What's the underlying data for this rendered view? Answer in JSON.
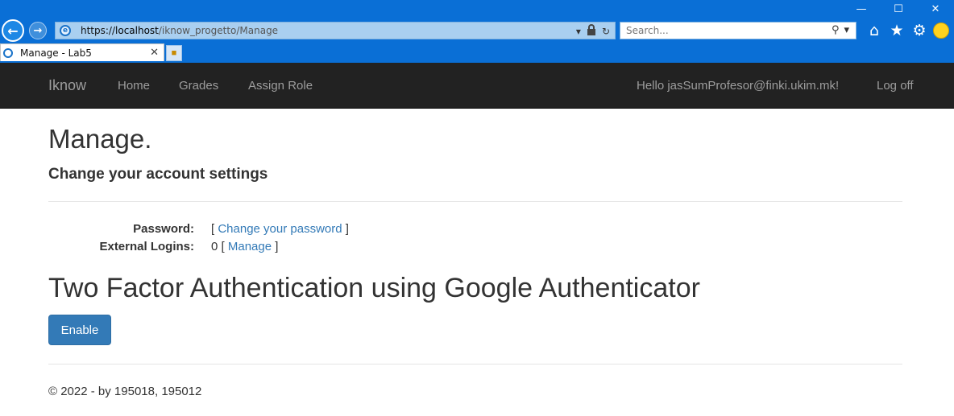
{
  "browser": {
    "address": {
      "protocol": "https://",
      "domain": "localhost",
      "path": "/iknow_progetto/Manage"
    },
    "search_placeholder": "Search...",
    "tab_title": "Manage - Lab5"
  },
  "navbar": {
    "brand": "Iknow",
    "links": [
      "Home",
      "Grades",
      "Assign Role"
    ],
    "greeting": "Hello jasSumProfesor@finki.ukim.mk!",
    "logoff": "Log off"
  },
  "page": {
    "title": "Manage.",
    "subtitle": "Change your account settings",
    "settings": {
      "password_label": "Password:",
      "password_open": "[ ",
      "password_link": "Change your password",
      "password_close": " ]",
      "external_label": "External Logins:",
      "external_count": "0",
      "external_open": " [ ",
      "external_link": "Manage",
      "external_close": " ]"
    },
    "two_factor_heading": "Two Factor Authentication using Google Authenticator",
    "enable_button": "Enable"
  },
  "footer": {
    "text": "© 2022 - by 195018, 195012"
  },
  "colors": {
    "chrome_blue": "#0a6fd6",
    "navbar_bg": "#222222",
    "link": "#337ab7",
    "primary_button": "#337ab7"
  },
  "icons": {
    "back": "back-arrow-icon",
    "forward": "forward-arrow-icon",
    "lock": "lock-icon",
    "refresh": "refresh-icon",
    "search": "search-icon",
    "home": "home-icon",
    "favorites": "star-icon",
    "settings": "gear-icon",
    "feedback": "smiley-icon"
  }
}
